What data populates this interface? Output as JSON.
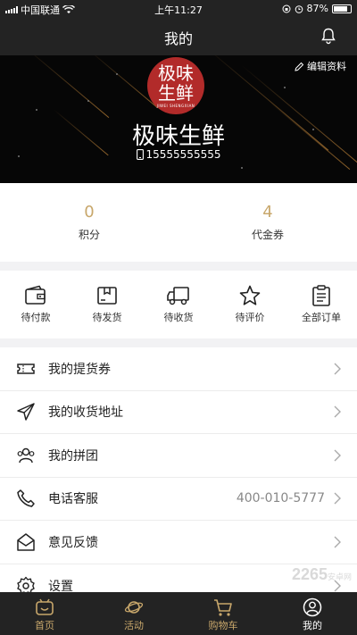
{
  "status_bar": {
    "carrier": "中国联通",
    "time": "上午11:27",
    "battery": "87%"
  },
  "nav": {
    "title": "我的"
  },
  "profile": {
    "logo_line1": "极味",
    "logo_line2": "生鲜",
    "logo_sub": "JIWEI SHENGXIAN",
    "edit_label": "编辑资料",
    "name": "极味生鲜",
    "phone": "15555555555"
  },
  "stats": [
    {
      "value": "0",
      "label": "积分"
    },
    {
      "value": "4",
      "label": "代金券"
    }
  ],
  "orders": [
    {
      "label": "待付款",
      "icon": "wallet-icon"
    },
    {
      "label": "待发货",
      "icon": "box-icon"
    },
    {
      "label": "待收货",
      "icon": "truck-icon"
    },
    {
      "label": "待评价",
      "icon": "star-icon"
    },
    {
      "label": "全部订单",
      "icon": "clipboard-icon"
    }
  ],
  "menu": [
    {
      "label": "我的提货券",
      "value": "",
      "icon": "ticket-icon"
    },
    {
      "label": "我的收货地址",
      "value": "",
      "icon": "send-icon"
    },
    {
      "label": "我的拼团",
      "value": "",
      "icon": "group-icon"
    },
    {
      "label": "电话客服",
      "value": "400-010-5777",
      "icon": "phone-icon"
    },
    {
      "label": "意见反馈",
      "value": "",
      "icon": "mail-icon"
    },
    {
      "label": "设置",
      "value": "",
      "icon": "gear-icon"
    }
  ],
  "tabs": [
    {
      "label": "首页",
      "icon": "home-icon"
    },
    {
      "label": "活动",
      "icon": "planet-icon"
    },
    {
      "label": "购物车",
      "icon": "cart-icon"
    },
    {
      "label": "我的",
      "icon": "user-icon"
    }
  ],
  "watermark": {
    "brand": "2265",
    "sub": "安卓网"
  },
  "colors": {
    "dark": "#232323",
    "gold": "#c8a76b",
    "logo_red": "#b22b2a"
  }
}
